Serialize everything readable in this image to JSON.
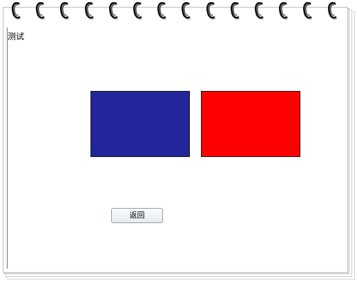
{
  "page": {
    "title": "测试"
  },
  "boxes": [
    {
      "name": "blue",
      "color": "#23259a"
    },
    {
      "name": "red",
      "color": "#ff0000"
    }
  ],
  "buttons": {
    "back_label": "返回"
  },
  "notebook": {
    "ring_count": 14,
    "ring_icon": "spiral-ring-icon"
  }
}
